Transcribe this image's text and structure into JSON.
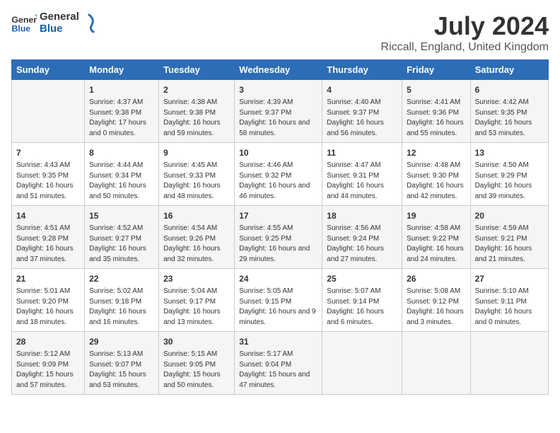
{
  "logo": {
    "text_general": "General",
    "text_blue": "Blue"
  },
  "title": "July 2024",
  "location": "Riccall, England, United Kingdom",
  "days": [
    "Sunday",
    "Monday",
    "Tuesday",
    "Wednesday",
    "Thursday",
    "Friday",
    "Saturday"
  ],
  "weeks": [
    [
      {
        "date": "",
        "content": ""
      },
      {
        "date": "1",
        "content": "Sunrise: 4:37 AM\nSunset: 9:38 PM\nDaylight: 17 hours\nand 0 minutes."
      },
      {
        "date": "2",
        "content": "Sunrise: 4:38 AM\nSunset: 9:38 PM\nDaylight: 16 hours\nand 59 minutes."
      },
      {
        "date": "3",
        "content": "Sunrise: 4:39 AM\nSunset: 9:37 PM\nDaylight: 16 hours\nand 58 minutes."
      },
      {
        "date": "4",
        "content": "Sunrise: 4:40 AM\nSunset: 9:37 PM\nDaylight: 16 hours\nand 56 minutes."
      },
      {
        "date": "5",
        "content": "Sunrise: 4:41 AM\nSunset: 9:36 PM\nDaylight: 16 hours\nand 55 minutes."
      },
      {
        "date": "6",
        "content": "Sunrise: 4:42 AM\nSunset: 9:35 PM\nDaylight: 16 hours\nand 53 minutes."
      }
    ],
    [
      {
        "date": "7",
        "content": "Sunrise: 4:43 AM\nSunset: 9:35 PM\nDaylight: 16 hours\nand 51 minutes."
      },
      {
        "date": "8",
        "content": "Sunrise: 4:44 AM\nSunset: 9:34 PM\nDaylight: 16 hours\nand 50 minutes."
      },
      {
        "date": "9",
        "content": "Sunrise: 4:45 AM\nSunset: 9:33 PM\nDaylight: 16 hours\nand 48 minutes."
      },
      {
        "date": "10",
        "content": "Sunrise: 4:46 AM\nSunset: 9:32 PM\nDaylight: 16 hours\nand 46 minutes."
      },
      {
        "date": "11",
        "content": "Sunrise: 4:47 AM\nSunset: 9:31 PM\nDaylight: 16 hours\nand 44 minutes."
      },
      {
        "date": "12",
        "content": "Sunrise: 4:48 AM\nSunset: 9:30 PM\nDaylight: 16 hours\nand 42 minutes."
      },
      {
        "date": "13",
        "content": "Sunrise: 4:50 AM\nSunset: 9:29 PM\nDaylight: 16 hours\nand 39 minutes."
      }
    ],
    [
      {
        "date": "14",
        "content": "Sunrise: 4:51 AM\nSunset: 9:28 PM\nDaylight: 16 hours\nand 37 minutes."
      },
      {
        "date": "15",
        "content": "Sunrise: 4:52 AM\nSunset: 9:27 PM\nDaylight: 16 hours\nand 35 minutes."
      },
      {
        "date": "16",
        "content": "Sunrise: 4:54 AM\nSunset: 9:26 PM\nDaylight: 16 hours\nand 32 minutes."
      },
      {
        "date": "17",
        "content": "Sunrise: 4:55 AM\nSunset: 9:25 PM\nDaylight: 16 hours\nand 29 minutes."
      },
      {
        "date": "18",
        "content": "Sunrise: 4:56 AM\nSunset: 9:24 PM\nDaylight: 16 hours\nand 27 minutes."
      },
      {
        "date": "19",
        "content": "Sunrise: 4:58 AM\nSunset: 9:22 PM\nDaylight: 16 hours\nand 24 minutes."
      },
      {
        "date": "20",
        "content": "Sunrise: 4:59 AM\nSunset: 9:21 PM\nDaylight: 16 hours\nand 21 minutes."
      }
    ],
    [
      {
        "date": "21",
        "content": "Sunrise: 5:01 AM\nSunset: 9:20 PM\nDaylight: 16 hours\nand 18 minutes."
      },
      {
        "date": "22",
        "content": "Sunrise: 5:02 AM\nSunset: 9:18 PM\nDaylight: 16 hours\nand 16 minutes."
      },
      {
        "date": "23",
        "content": "Sunrise: 5:04 AM\nSunset: 9:17 PM\nDaylight: 16 hours\nand 13 minutes."
      },
      {
        "date": "24",
        "content": "Sunrise: 5:05 AM\nSunset: 9:15 PM\nDaylight: 16 hours\nand 9 minutes."
      },
      {
        "date": "25",
        "content": "Sunrise: 5:07 AM\nSunset: 9:14 PM\nDaylight: 16 hours\nand 6 minutes."
      },
      {
        "date": "26",
        "content": "Sunrise: 5:08 AM\nSunset: 9:12 PM\nDaylight: 16 hours\nand 3 minutes."
      },
      {
        "date": "27",
        "content": "Sunrise: 5:10 AM\nSunset: 9:11 PM\nDaylight: 16 hours\nand 0 minutes."
      }
    ],
    [
      {
        "date": "28",
        "content": "Sunrise: 5:12 AM\nSunset: 9:09 PM\nDaylight: 15 hours\nand 57 minutes."
      },
      {
        "date": "29",
        "content": "Sunrise: 5:13 AM\nSunset: 9:07 PM\nDaylight: 15 hours\nand 53 minutes."
      },
      {
        "date": "30",
        "content": "Sunrise: 5:15 AM\nSunset: 9:05 PM\nDaylight: 15 hours\nand 50 minutes."
      },
      {
        "date": "31",
        "content": "Sunrise: 5:17 AM\nSunset: 9:04 PM\nDaylight: 15 hours\nand 47 minutes."
      },
      {
        "date": "",
        "content": ""
      },
      {
        "date": "",
        "content": ""
      },
      {
        "date": "",
        "content": ""
      }
    ]
  ]
}
